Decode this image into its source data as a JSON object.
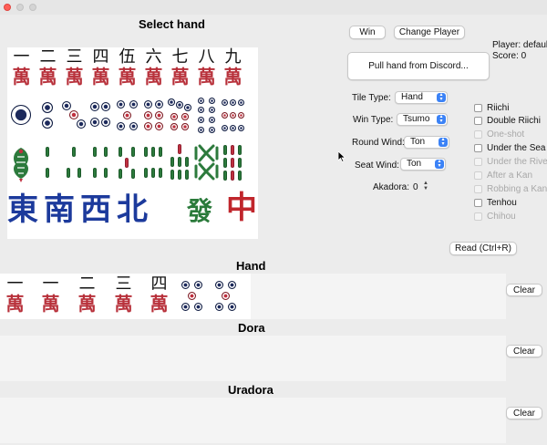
{
  "window": {
    "traffic_lights": [
      "close",
      "minimize",
      "zoom"
    ]
  },
  "headings": {
    "select_hand": "Select hand",
    "hand": "Hand",
    "dora": "Dora",
    "uradora": "Uradora"
  },
  "buttons": {
    "win": "Win",
    "change_player": "Change Player",
    "pull_hand": "Pull hand from Discord...",
    "read": "Read (Ctrl+R)",
    "clear": "Clear"
  },
  "player": {
    "player_label": "Player: default",
    "score_label": "Score: 0"
  },
  "form": {
    "tile_type": {
      "label": "Tile Type:",
      "value": "Hand"
    },
    "win_type": {
      "label": "Win Type:",
      "value": "Tsumo"
    },
    "round_wind": {
      "label": "Round Wind:",
      "value": "Ton"
    },
    "seat_wind": {
      "label": "Seat Wind:",
      "value": "Ton"
    },
    "akadora": {
      "label": "Akadora:",
      "value": "0"
    }
  },
  "checkboxes": [
    {
      "label": "Riichi",
      "enabled": true,
      "checked": false
    },
    {
      "label": "Double Riichi",
      "enabled": true,
      "checked": false
    },
    {
      "label": "One-shot",
      "enabled": false,
      "checked": false
    },
    {
      "label": "Under the Sea",
      "enabled": true,
      "checked": false
    },
    {
      "label": "Under the River",
      "enabled": false,
      "checked": false
    },
    {
      "label": "After a Kan",
      "enabled": false,
      "checked": false
    },
    {
      "label": "Robbing a Kan",
      "enabled": false,
      "checked": false
    },
    {
      "label": "Tenhou",
      "enabled": true,
      "checked": false
    },
    {
      "label": "Chihou",
      "enabled": false,
      "checked": false
    }
  ],
  "palette": {
    "man_numbers": [
      "一",
      "二",
      "三",
      "四",
      "伍",
      "六",
      "七",
      "八",
      "九"
    ],
    "man_suffix": "萬",
    "honors": [
      "東",
      "南",
      "西",
      "北",
      "發",
      "中"
    ]
  },
  "hand": {
    "man_numbers": [
      "一",
      "一",
      "二",
      "三",
      "四"
    ],
    "man_suffix": "萬"
  },
  "colors": {
    "man_red": "#b8313b",
    "pin_navy": "#1d2a5c",
    "sou_green": "#2c7a3c",
    "honor_blue": "#1c3a9c",
    "dragon_red": "#c0262c",
    "dragon_green": "#2a7a3a",
    "accent": "#3b82f6"
  }
}
